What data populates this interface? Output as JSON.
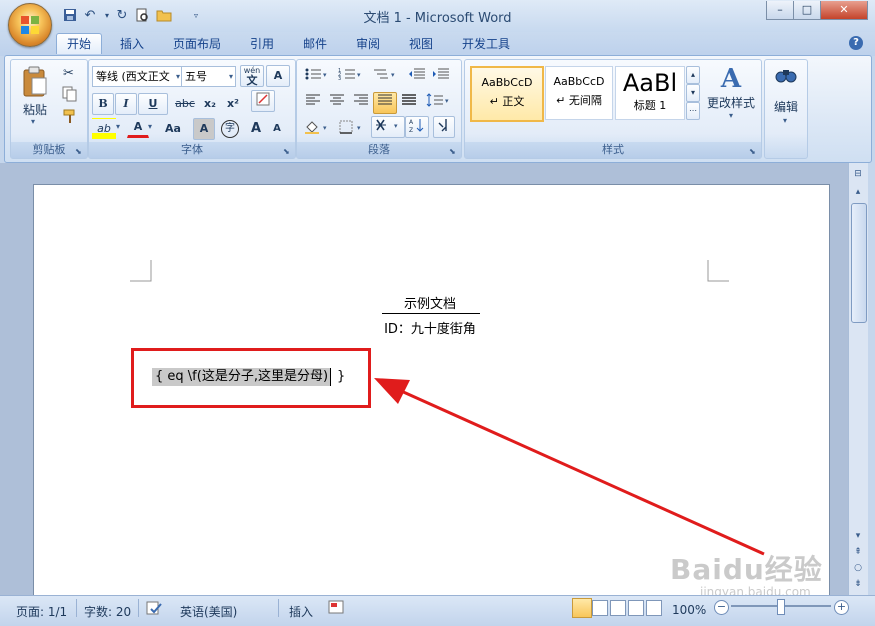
{
  "window": {
    "title": "文档 1 - Microsoft Word",
    "minimize": "–",
    "restore": "□",
    "close": "✕"
  },
  "tabs": [
    "开始",
    "插入",
    "页面布局",
    "引用",
    "邮件",
    "审阅",
    "视图",
    "开发工具"
  ],
  "help_glyph": "?",
  "ribbon": {
    "clipboard": {
      "paste": "粘贴",
      "label": "剪贴板"
    },
    "font": {
      "font_name": "等线 (西文正文",
      "font_size": "五号",
      "wen_glyph": "wén",
      "a_glyph": "A",
      "bold": "B",
      "italic": "I",
      "underline": "U",
      "strike": "abc",
      "subscript": "x₂",
      "superscript": "x²",
      "highlight": "ab",
      "font_color": "A",
      "change_case": "Aa",
      "char_shading": "A",
      "enclose": "字",
      "grow": "A",
      "shrink": "A",
      "label": "字体"
    },
    "paragraph": {
      "label": "段落"
    },
    "styles": {
      "items": [
        {
          "sample": "AaBbCcD",
          "name": "↵ 正文"
        },
        {
          "sample": "AaBbCcD",
          "name": "↵ 无间隔"
        },
        {
          "sample": "AaBl",
          "name": "标题 1"
        }
      ],
      "change_styles": "更改样式",
      "label": "样式"
    },
    "editing": {
      "label": "编辑"
    }
  },
  "document": {
    "title": "示例文档",
    "subtitle": "ID：九十度街角",
    "field_code": "{ eq \\f(这是分子,这里是分母)",
    "field_close": "}"
  },
  "statusbar": {
    "page": "页面: 1/1",
    "words": "字数: 20",
    "language": "英语(美国)",
    "mode": "插入",
    "zoom": "100%",
    "zoom_minus": "−",
    "zoom_plus": "+"
  },
  "watermark": "Baidu经验",
  "watermark_url": "jingyan.baidu.com",
  "colors": {
    "annotation": "#e01c1c",
    "ribbon_accent": "#15428b"
  }
}
